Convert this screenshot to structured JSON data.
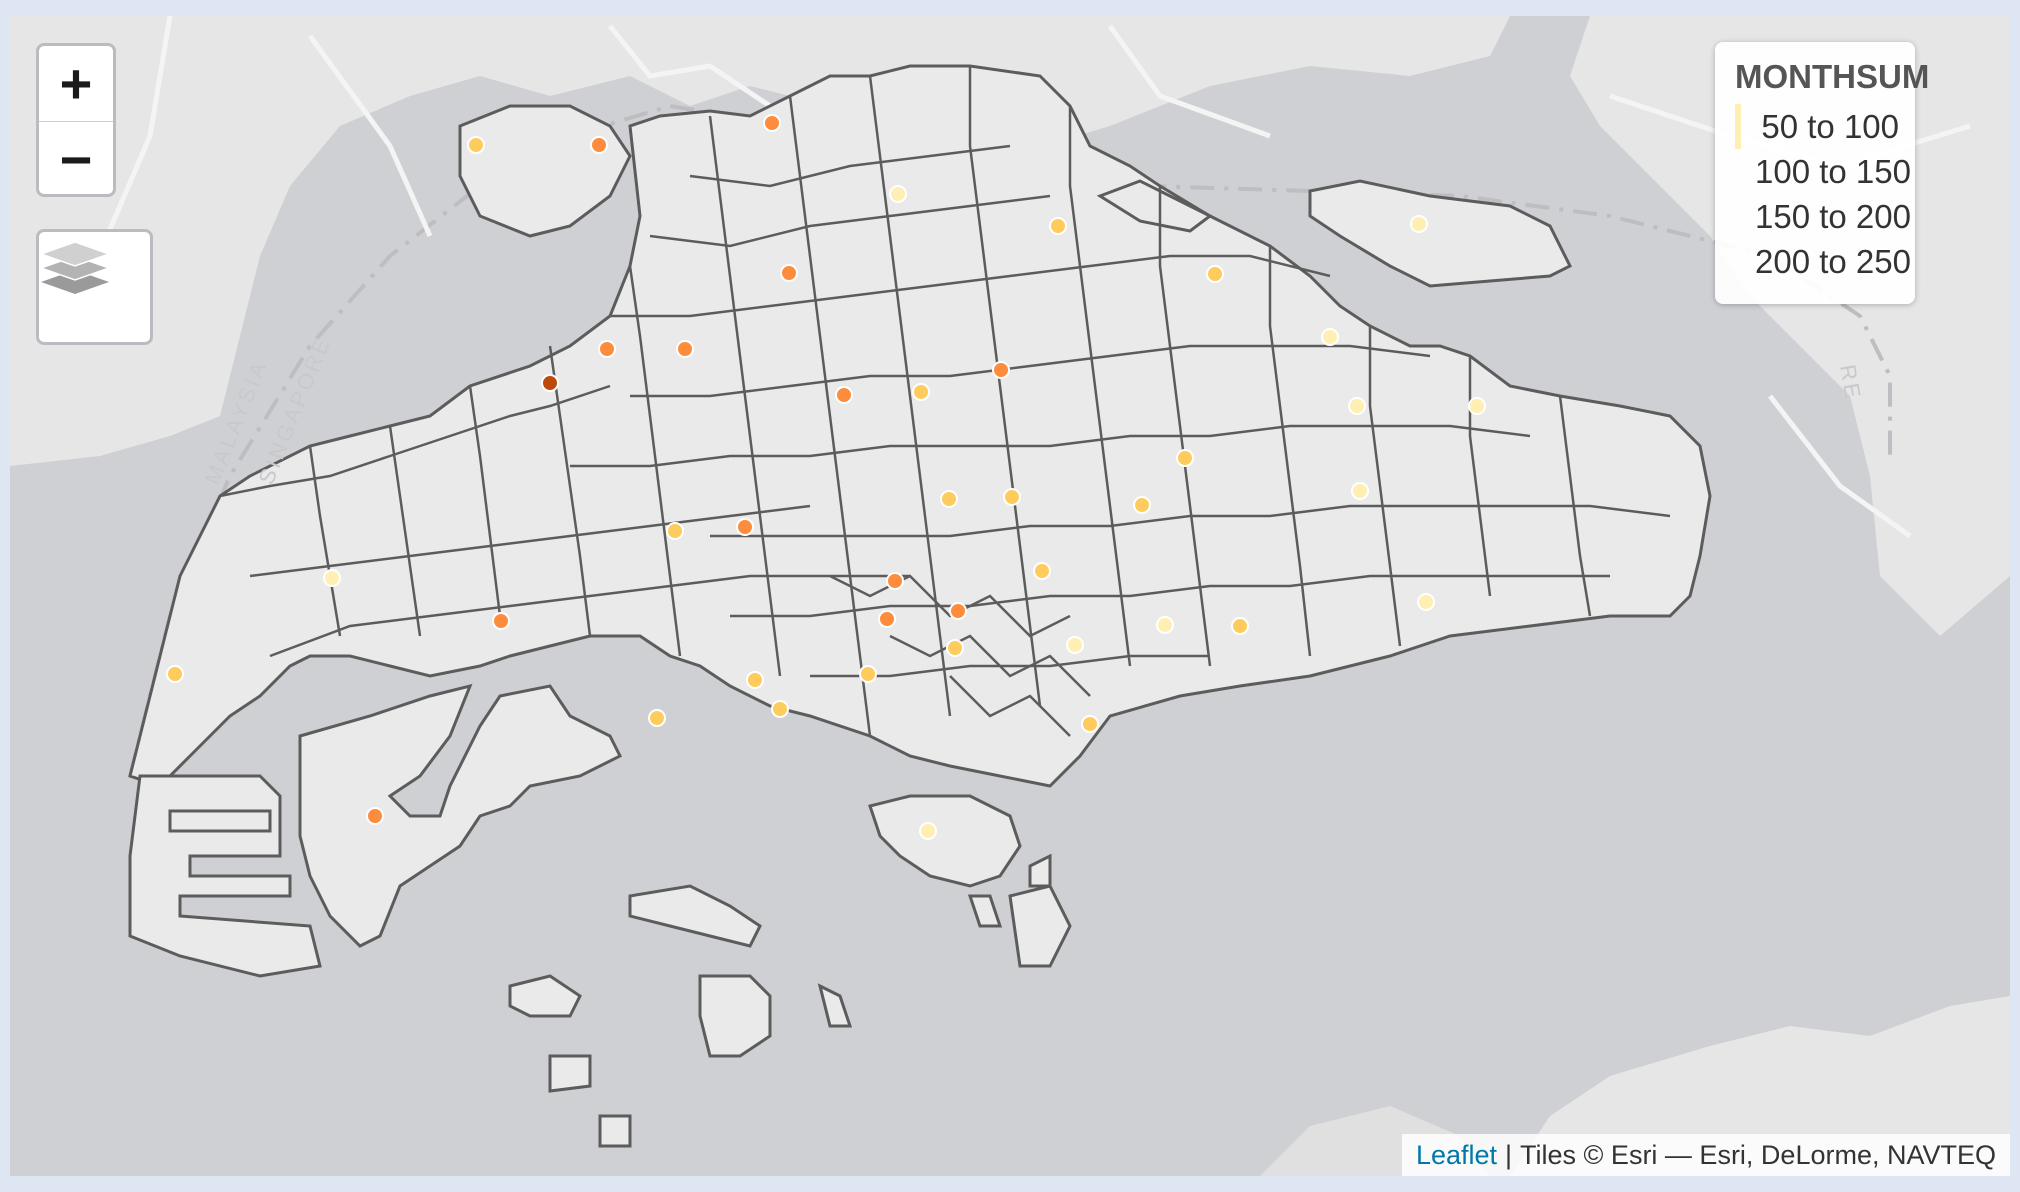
{
  "map": {
    "legend": {
      "title": "MONTHSUM",
      "items": [
        {
          "label": "50 to 100",
          "color": "#ffefb2"
        },
        {
          "label": "100 to 150",
          "color": "#fecc5c"
        },
        {
          "label": "150 to 200",
          "color": "#fd8d3c"
        },
        {
          "label": "200 to 250",
          "color": "#bd4a0a"
        }
      ]
    },
    "controls": {
      "zoom_in": "+",
      "zoom_out": "−",
      "layers_icon": "layers-icon"
    },
    "basemap_labels": {
      "border_left_1": "MALAYSIA",
      "border_left_2": "SINGAPORE",
      "border_right": "RE"
    },
    "attribution": {
      "link": "Leaflet",
      "separator": "|",
      "text": "Tiles © Esri — Esri, DeLorme, NAVTEQ"
    },
    "colors": {
      "water": "#cfd0d4",
      "land": "#e6e6e6",
      "subzone_fill": "#eaeaea",
      "subzone_border": "#5c5c5c"
    }
  }
}
